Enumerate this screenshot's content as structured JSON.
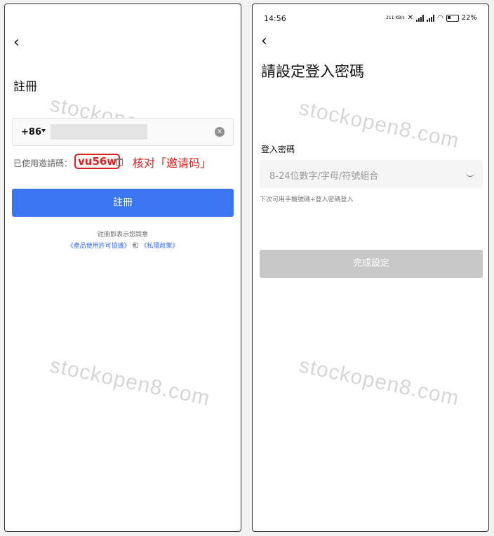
{
  "left": {
    "back_icon": "chevron-left-icon",
    "title": "註冊",
    "country_code": "+86",
    "clear_icon": "×",
    "invite_label": "已使用邀請碼：",
    "invite_code": "vu56w",
    "annotation": "核对「邀请码」",
    "register_button": "註冊",
    "terms_line1": "註冊即表示您同意",
    "terms_link1": "《產品使用許可協議》",
    "terms_and": " 和 ",
    "terms_link2": "《私隱政策》",
    "watermark": "stockopen8.com"
  },
  "right": {
    "status_time": "14:56",
    "status_speed": "211 KB/s",
    "battery_percent": "22%",
    "back_icon": "chevron-left-icon",
    "title": "請設定登入密碼",
    "password_label": "登入密碼",
    "password_placeholder": "8-24位數字/字母/符號組合",
    "hint": "下次可用手機號碼+登入密碼登入",
    "done_button": "完成設定",
    "watermark": "stockopen8.com"
  }
}
